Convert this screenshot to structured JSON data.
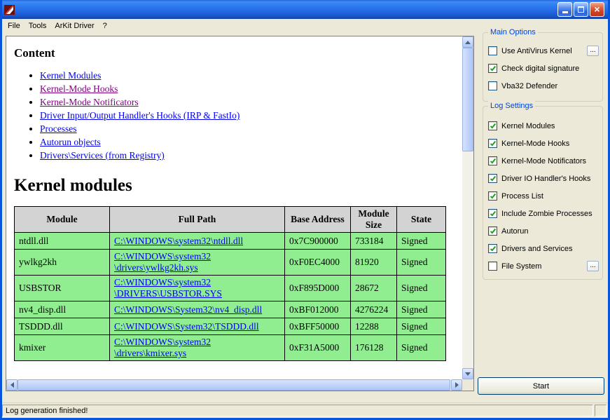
{
  "window": {
    "title": ""
  },
  "ui": {
    "close_glyph": "×",
    "more_label": "..."
  },
  "menu": {
    "items": [
      {
        "label": "File"
      },
      {
        "label": "Tools"
      },
      {
        "label": "ArKit Driver"
      },
      {
        "label": "?"
      }
    ]
  },
  "report": {
    "content_heading": "Content",
    "toc": [
      {
        "label": "Kernel Modules",
        "visited": false
      },
      {
        "label": "Kernel-Mode Hooks",
        "visited": true
      },
      {
        "label": "Kernel-Mode Notificators",
        "visited": true
      },
      {
        "label": "Driver Input/Output Handler's Hooks (IRP & FastIo)",
        "visited": false
      },
      {
        "label": "Processes",
        "visited": false
      },
      {
        "label": "Autorun objects",
        "visited": false
      },
      {
        "label": "Drivers\\Services (from Registry)",
        "visited": false
      }
    ],
    "section_heading": "Kernel modules",
    "table": {
      "headers": [
        "Module",
        "Full Path",
        "Base Address",
        "Module Size",
        "State"
      ],
      "rows": [
        {
          "module": "ntdll.dll",
          "path": "C:\\WINDOWS\\system32\\ntdll.dll",
          "base": "0x7C900000",
          "size": "733184",
          "state": "Signed"
        },
        {
          "module": "ywlkg2kh",
          "path": "C:\\WINDOWS\\system32\n\\drivers\\ywlkg2kh.sys",
          "base": "0xF0EC4000",
          "size": "81920",
          "state": "Signed"
        },
        {
          "module": "USBSTOR",
          "path": "C:\\WINDOWS\\system32\n\\DRIVERS\\USBSTOR.SYS",
          "base": "0xF895D000",
          "size": "28672",
          "state": "Signed"
        },
        {
          "module": "nv4_disp.dll",
          "path": "C:\\WINDOWS\\System32\\nv4_disp.dll",
          "base": "0xBF012000",
          "size": "4276224",
          "state": "Signed"
        },
        {
          "module": "TSDDD.dll",
          "path": "C:\\WINDOWS\\System32\\TSDDD.dll",
          "base": "0xBFF50000",
          "size": "12288",
          "state": "Signed"
        },
        {
          "module": "kmixer",
          "path": "C:\\WINDOWS\\system32\n\\drivers\\kmixer.sys",
          "base": "0xF31A5000",
          "size": "176128",
          "state": "Signed"
        }
      ]
    }
  },
  "main_options": {
    "title": "Main Options",
    "items": [
      {
        "label": "Use AntiVirus Kernel",
        "checked": false,
        "has_more": true
      },
      {
        "label": "Check digital signature",
        "checked": true
      },
      {
        "label": "Vba32 Defender",
        "checked": false
      }
    ]
  },
  "log_settings": {
    "title": "Log Settings",
    "items": [
      {
        "label": "Kernel Modules",
        "checked": true
      },
      {
        "label": "Kernel-Mode Hooks",
        "checked": true
      },
      {
        "label": "Kernel-Mode Notificators",
        "checked": true
      },
      {
        "label": "Driver IO Handler's Hooks",
        "checked": true
      },
      {
        "label": "Process List",
        "checked": true
      },
      {
        "label": "Include Zombie Processes",
        "checked": true
      },
      {
        "label": "Autorun",
        "checked": true
      },
      {
        "label": "Drivers and Services",
        "checked": true
      },
      {
        "label": "File System",
        "checked": false,
        "has_more": true
      }
    ]
  },
  "start_button_label": "Start",
  "status_bar": {
    "message": "Log generation finished!"
  },
  "colors": {
    "link": "#0000EE",
    "visited_link": "#800080",
    "table_row_green": "#90EE90",
    "table_header_gray": "#D3D3D3",
    "group_title_blue": "#0046D5",
    "check_green": "#21A121"
  }
}
